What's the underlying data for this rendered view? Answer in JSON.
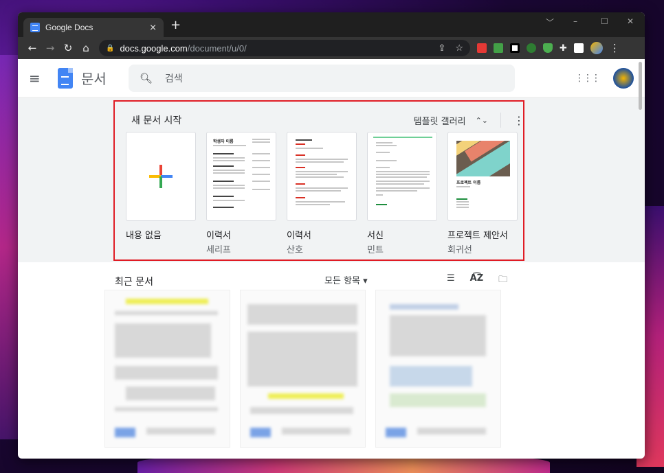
{
  "browser": {
    "tab_title": "Google Docs",
    "tab_close": "×",
    "new_tab": "+",
    "url_host": "docs.google.com",
    "url_path": "/document/u/0/",
    "window_controls": [
      "﹀",
      "–",
      "☐",
      "✕"
    ]
  },
  "header": {
    "app_name": "문서",
    "search_placeholder": "검색"
  },
  "templates": {
    "section_title": "새 문서 시작",
    "gallery_label": "템플릿 갤러리",
    "items": [
      {
        "title": "내용 없음",
        "subtitle": ""
      },
      {
        "title": "이력서",
        "subtitle": "세리프"
      },
      {
        "title": "이력서",
        "subtitle": "산호"
      },
      {
        "title": "서신",
        "subtitle": "민트"
      },
      {
        "title": "프로젝트 제안서",
        "subtitle": "회귀선"
      }
    ],
    "thumb_texts": {
      "resume_serif_name": "학생자 이름",
      "project_name": "프로젝트 이름"
    }
  },
  "recent": {
    "section_title": "최근 문서",
    "owner_filter": "모든 항목"
  },
  "colors": {
    "highlight_border": "#e01b24",
    "docs_blue": "#4285f4"
  }
}
